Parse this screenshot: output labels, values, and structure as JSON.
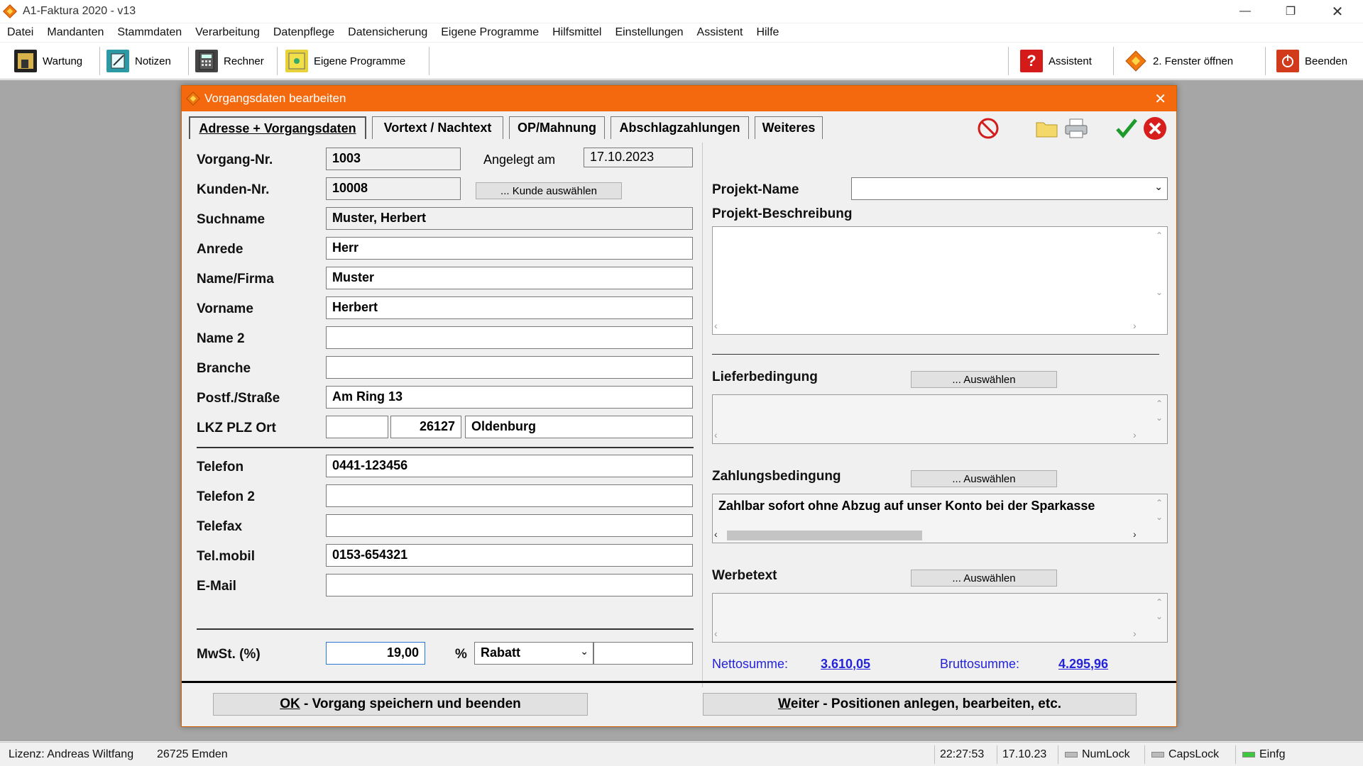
{
  "window": {
    "title": "A1-Faktura 2020 - v13"
  },
  "menu": [
    "Datei",
    "Mandanten",
    "Stammdaten",
    "Verarbeitung",
    "Datenpflege",
    "Datensicherung",
    "Eigene Programme",
    "Hilfsmittel",
    "Einstellungen",
    "Assistent",
    "Hilfe"
  ],
  "toolbar": {
    "wartung": "Wartung",
    "notizen": "Notizen",
    "rechner": "Rechner",
    "eigene": "Eigene Programme",
    "assistent": "Assistent",
    "fenster": "2. Fenster öffnen",
    "beenden": "Beenden"
  },
  "dialog": {
    "title": "Vorgangsdaten bearbeiten",
    "tabs": [
      "Adresse + Vorgangsdaten",
      "Vortext / Nachtext",
      "OP/Mahnung",
      "Abschlagzahlungen",
      "Weiteres"
    ],
    "labels": {
      "vorgang_nr": "Vorgang-Nr.",
      "kunden_nr": "Kunden-Nr.",
      "suchname": "Suchname",
      "anrede": "Anrede",
      "name_firma": "Name/Firma",
      "vorname": "Vorname",
      "name2": "Name 2",
      "branche": "Branche",
      "strasse": "Postf./Straße",
      "lkz_plz_ort": "LKZ PLZ Ort",
      "telefon": "Telefon",
      "telefon2": "Telefon 2",
      "telefax": "Telefax",
      "telmobil": "Tel.mobil",
      "email": "E-Mail",
      "mwst": "MwSt. (%)",
      "percent": "%",
      "angelegt": "Angelegt am",
      "projekt_name": "Projekt-Name",
      "projekt_beschreibung": "Projekt-Beschreibung",
      "lieferbedingung": "Lieferbedingung",
      "zahlungsbedingung": "Zahlungsbedingung",
      "werbetext": "Werbetext",
      "nettosumme": "Nettosumme:",
      "bruttosumme": "Bruttosumme:"
    },
    "values": {
      "vorgang_nr": "1003",
      "kunden_nr": "10008",
      "angelegt": "17.10.2023",
      "suchname": "Muster, Herbert",
      "anrede": "Herr",
      "name_firma": "Muster",
      "vorname": "Herbert",
      "name2": "",
      "branche": "",
      "strasse": "Am Ring 13",
      "lkz": "",
      "plz": "26127",
      "ort": "Oldenburg",
      "telefon": "0441-123456",
      "telefon2": "",
      "telefax": "",
      "telmobil": "0153-654321",
      "email": "",
      "mwst": "19,00",
      "rabatt_type": "Rabatt",
      "rabatt_value": "",
      "projekt_name": "",
      "zahlungsbedingung_text": "Zahlbar sofort ohne Abzug auf unser Konto bei der Sparkasse",
      "nettosumme": "3.610,05",
      "bruttosumme": "4.295,96"
    },
    "buttons": {
      "kunde_auswaehlen": "... Kunde auswählen",
      "auswaehlen": "... Auswählen",
      "ok_prefix": "OK",
      "ok_rest": " - Vorgang speichern und beenden",
      "weiter_first": "W",
      "weiter_rest": "eiter - Positionen anlegen, bearbeiten, etc."
    }
  },
  "status": {
    "lizenz": "Lizenz: Andreas Wiltfang",
    "ort": "26725 Emden",
    "time": "22:27:53",
    "date": "17.10.23",
    "numlock": "NumLock",
    "capslock": "CapsLock",
    "einfg": "Einfg"
  },
  "colors": {
    "accent": "#f5690e",
    "link": "#2323d9",
    "desk": "#a6a6a6"
  }
}
